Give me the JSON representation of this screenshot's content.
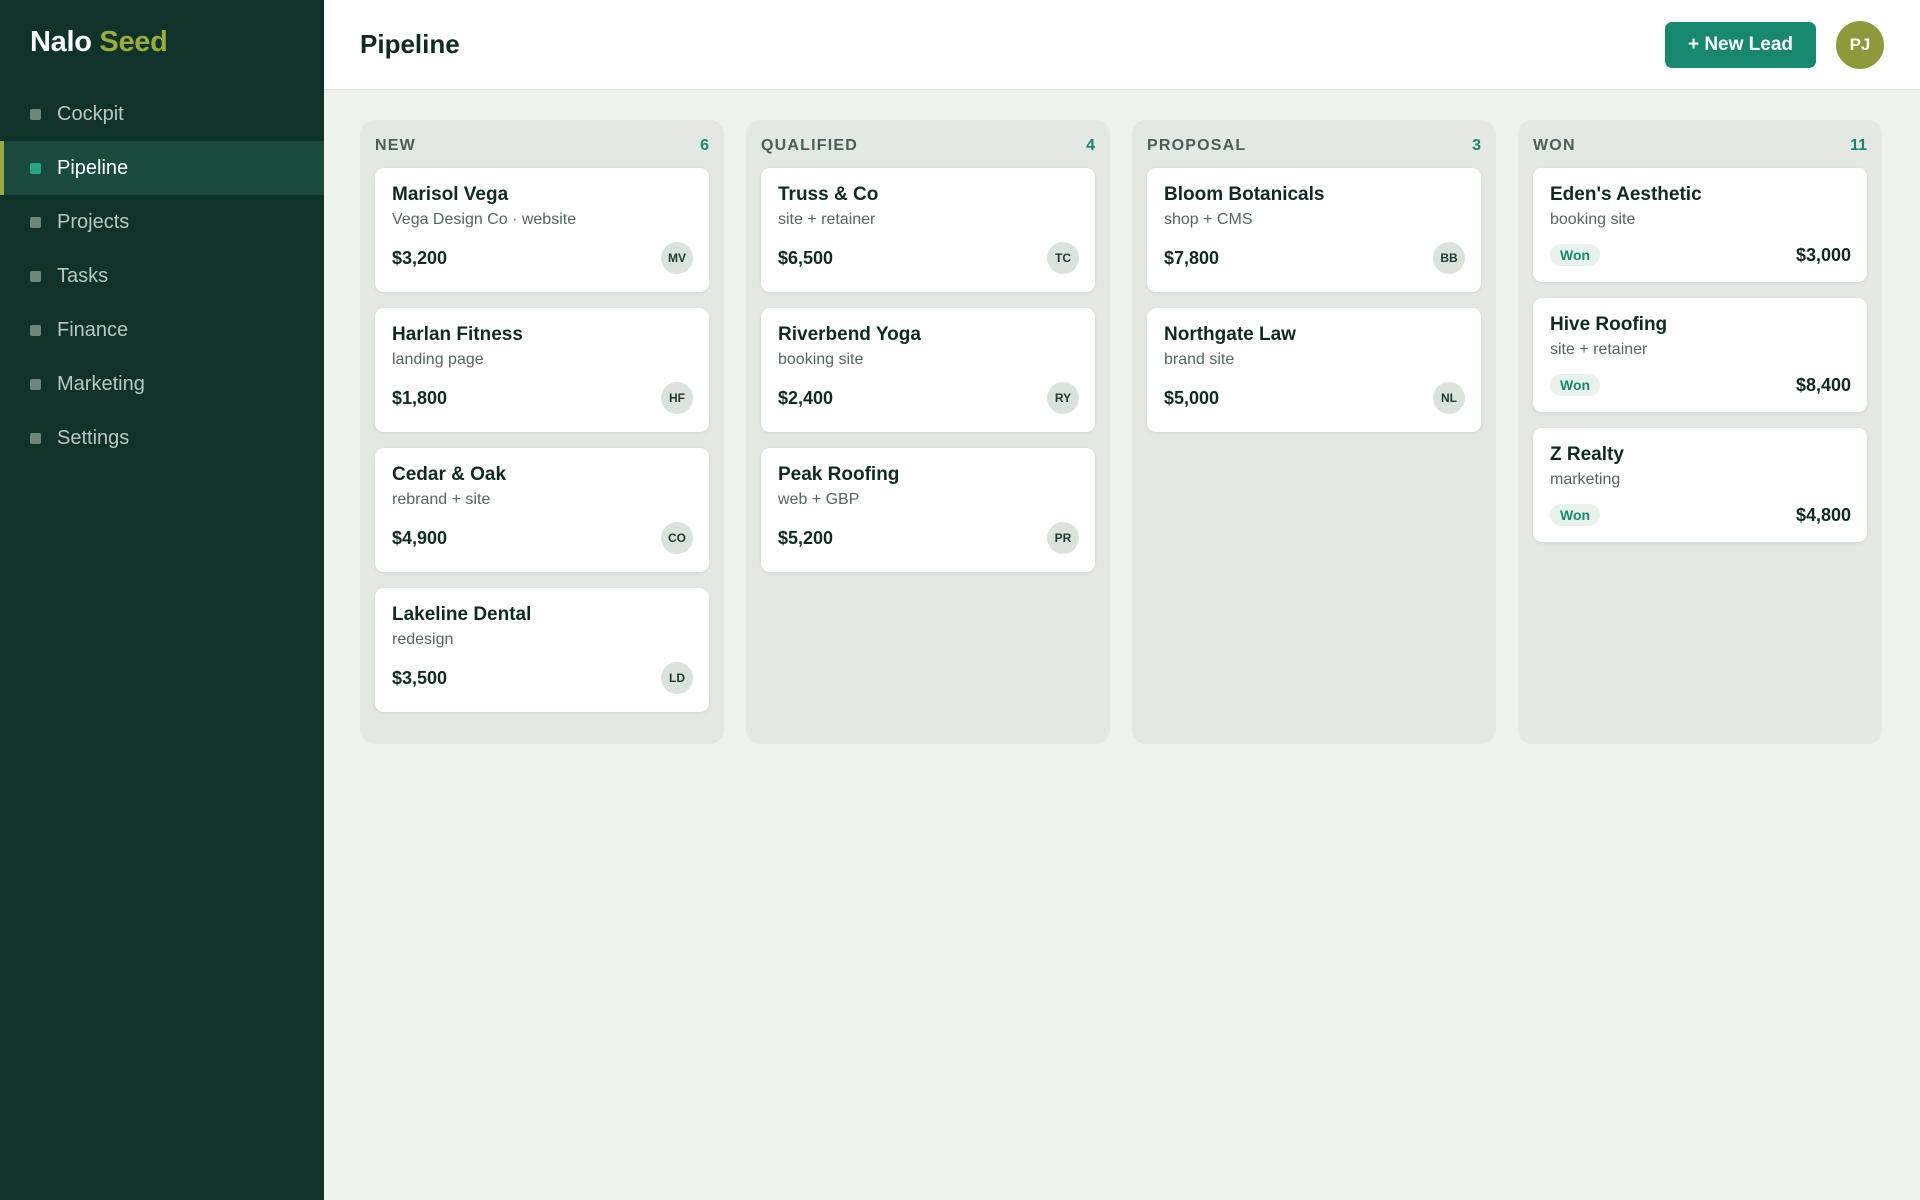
{
  "brand": {
    "name": "Nalo",
    "accent": "Seed"
  },
  "nav": [
    {
      "label": "Cockpit",
      "icon": "square-bullet",
      "active": false
    },
    {
      "label": "Pipeline",
      "icon": "square-bullet",
      "active": true
    },
    {
      "label": "Projects",
      "icon": "square-bullet",
      "active": false
    },
    {
      "label": "Tasks",
      "icon": "square-bullet",
      "active": false
    },
    {
      "label": "Finance",
      "icon": "square-bullet",
      "active": false
    },
    {
      "label": "Marketing",
      "icon": "square-bullet",
      "active": false
    },
    {
      "label": "Settings",
      "icon": "square-bullet",
      "active": false
    }
  ],
  "header": {
    "title": "Pipeline",
    "new_lead_label": "+ New Lead",
    "user_initials": "PJ"
  },
  "colors": {
    "sidebar": "#0f332b",
    "accent_green": "#17876d",
    "brand_olive": "#9bab3e",
    "avatar_olive": "#8d9a3b"
  },
  "columns": [
    {
      "title": "NEW",
      "count": "6",
      "cards": [
        {
          "name": "Marisol Vega",
          "desc": "Vega Design Co · website",
          "value": "$3,200",
          "initials": "MV"
        },
        {
          "name": "Harlan Fitness",
          "desc": "landing page",
          "value": "$1,800",
          "initials": "HF"
        },
        {
          "name": "Cedar & Oak",
          "desc": "rebrand + site",
          "value": "$4,900",
          "initials": "CO"
        },
        {
          "name": "Lakeline Dental",
          "desc": "redesign",
          "value": "$3,500",
          "initials": "LD"
        }
      ]
    },
    {
      "title": "QUALIFIED",
      "count": "4",
      "cards": [
        {
          "name": "Truss & Co",
          "desc": "site + retainer",
          "value": "$6,500",
          "initials": "TC"
        },
        {
          "name": "Riverbend Yoga",
          "desc": "booking site",
          "value": "$2,400",
          "initials": "RY"
        },
        {
          "name": "Peak Roofing",
          "desc": "web + GBP",
          "value": "$5,200",
          "initials": "PR"
        }
      ]
    },
    {
      "title": "PROPOSAL",
      "count": "3",
      "cards": [
        {
          "name": "Bloom Botanicals",
          "desc": "shop + CMS",
          "value": "$7,800",
          "initials": "BB"
        },
        {
          "name": "Northgate Law",
          "desc": "brand site",
          "value": "$5,000",
          "initials": "NL"
        }
      ]
    },
    {
      "title": "WON",
      "count": "11",
      "cards": [
        {
          "name": "Eden's Aesthetic",
          "desc": "booking site",
          "value": "$3,000",
          "badge": "Won"
        },
        {
          "name": "Hive Roofing",
          "desc": "site + retainer",
          "value": "$8,400",
          "badge": "Won"
        },
        {
          "name": "Z Realty",
          "desc": "marketing",
          "value": "$4,800",
          "badge": "Won"
        }
      ]
    }
  ]
}
